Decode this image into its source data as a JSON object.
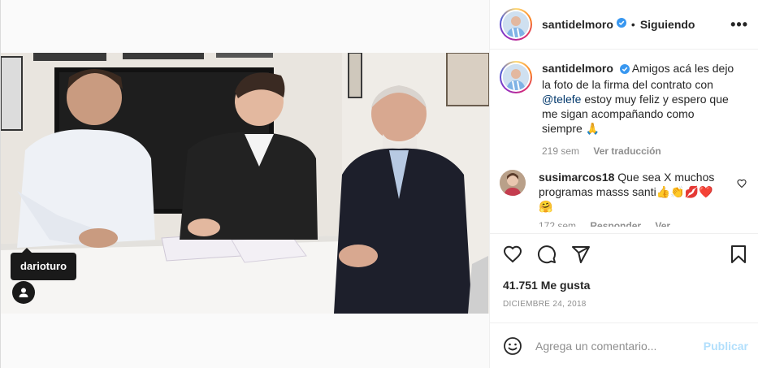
{
  "post": {
    "username": "santidelmoro",
    "follow_status": "Siguiendo",
    "more_label": "•••",
    "separator": "•"
  },
  "media": {
    "tag_username": "darioturo",
    "icons": {
      "user_tag": "user-tag-icon"
    }
  },
  "caption": {
    "username": "santidelmoro",
    "text_before": "Amigos acá les dejo la foto de la firma del contrato con ",
    "mention": "@telefe",
    "text_after": " estoy muy feliz y espero que me sigan acompañando como siempre 🙏",
    "time": "219 sem",
    "translate": "Ver traducción"
  },
  "comments": [
    {
      "username": "susimarcos18",
      "text": "Que sea X muchos programas masss santi👍👏💋❤️ 🤗",
      "meta_time": "172 sem",
      "meta_reply": "Responder",
      "meta_translate": "Ver traducción"
    }
  ],
  "actions": {
    "icons": [
      "heart-icon",
      "comment-icon",
      "share-icon",
      "bookmark-icon"
    ]
  },
  "likes": "41.751 Me gusta",
  "date": "DICIEMBRE 24, 2018",
  "add_comment": {
    "placeholder": "Agrega un comentario...",
    "publish_label": "Publicar"
  },
  "colors": {
    "accent": "#0095f6",
    "publish_disabled": "#b2dffc",
    "muted": "#8e8e8e",
    "verified": "#3897f0"
  }
}
